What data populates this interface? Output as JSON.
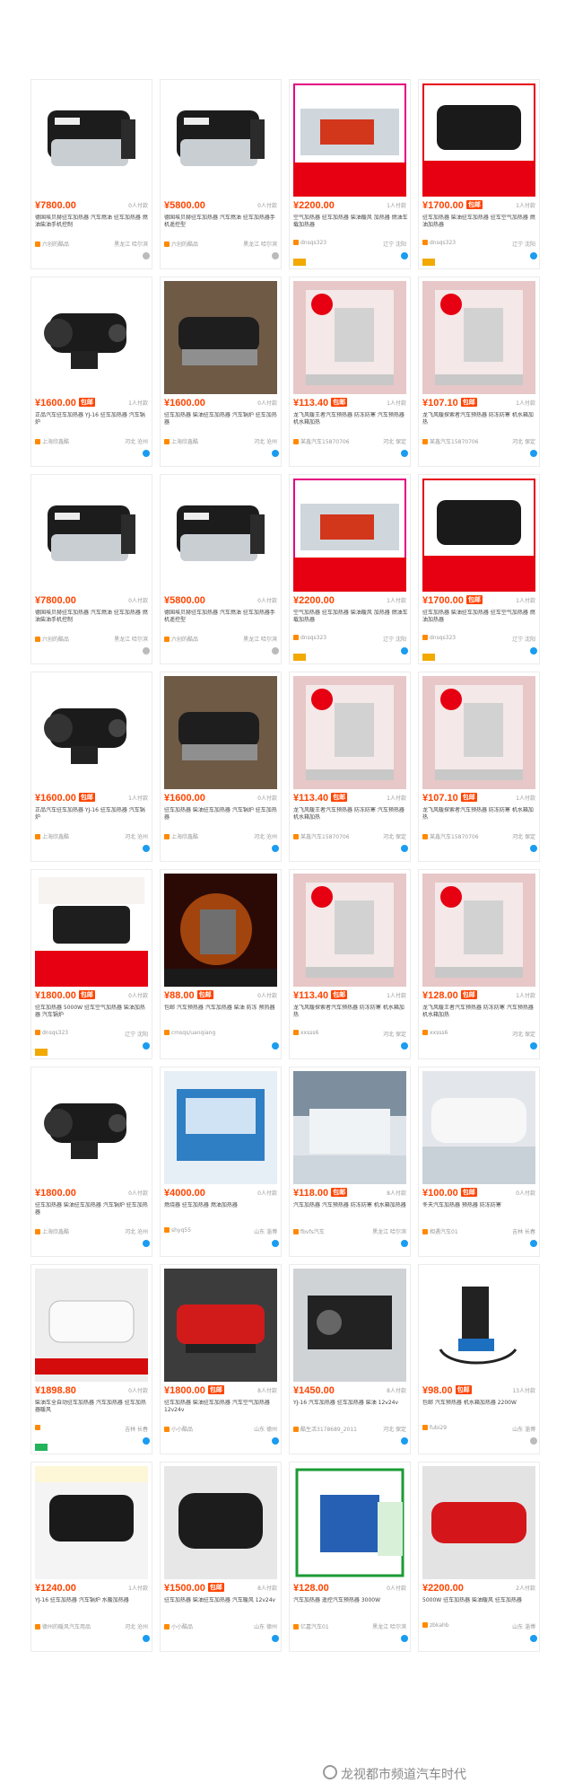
{
  "watermark": "龙视都市频道汽车时代",
  "rows": [
    [
      {
        "img": "heater-silver",
        "price": "¥7800.00",
        "badge": "",
        "sales": "0人付款",
        "t1": "德国埃贝赫驻车加热器 汽车燃油 驻车加热器 燃油柴油手机控制",
        "shop": "六创的酷品",
        "loc": "黑龙江 哈尔滨",
        "tags": [],
        "wang": "grey"
      },
      {
        "img": "heater-silver",
        "price": "¥5800.00",
        "badge": "",
        "sales": "0人付款",
        "t1": "德国埃贝赫驻车加热器 汽车燃油 驻车加热器手机遥控型",
        "shop": "六创的酷品",
        "loc": "黑龙江 哈尔滨",
        "tags": [],
        "wang": "grey"
      },
      {
        "img": "poster-red",
        "price": "¥2200.00",
        "badge": "",
        "sales": "1人付款",
        "t1": "空气加热器 驻车加热器 柴油暖风 加热器 燃油车载加热器",
        "shop": "dnsqs323",
        "loc": "辽宁 沈阳",
        "tags": [
          "gold"
        ],
        "wang": "blue"
      },
      {
        "img": "poster-black",
        "price": "¥1700.00",
        "badge": "包邮",
        "sales": "1人付款",
        "t1": "驻车加热器 柴油驻车加热器 驻车空气加热器 燃油加热器",
        "shop": "dnsqs323",
        "loc": "辽宁 沈阳",
        "tags": [
          "gold"
        ],
        "wang": "blue"
      }
    ],
    [
      {
        "img": "heater-black",
        "price": "¥1600.00",
        "badge": "包邮",
        "sales": "1人付款",
        "t1": "正品汽车驻车加热器 YJ-16 驻车加热器 汽车锅炉",
        "shop": "上海欣鑫酷",
        "loc": "河北 沧州",
        "tags": [],
        "wang": "blue"
      },
      {
        "img": "heater-car",
        "price": "¥1600.00",
        "badge": "",
        "sales": "0人付款",
        "t1": "驻车加热器 柴油驻车加热器 汽车锅炉 驻车加热器",
        "shop": "上海欣鑫酷",
        "loc": "河北 沧州",
        "tags": [],
        "wang": "blue"
      },
      {
        "img": "box-pink",
        "price": "¥113.40",
        "badge": "包邮",
        "sales": "1人付款",
        "t1": "龙飞风暖王者汽车预热器 防冻防寒 汽车预热器 机水箱加热",
        "shop": "某鑫汽车15870706",
        "loc": "河北 保定",
        "tags": [],
        "wang": "blue"
      },
      {
        "img": "box-pink",
        "price": "¥107.10",
        "badge": "包邮",
        "sales": "1人付款",
        "t1": "龙飞风暖探索者汽车预热器 防冻防寒 机水箱加热",
        "shop": "某鑫汽车15870706",
        "loc": "河北 保定",
        "tags": [],
        "wang": "blue"
      }
    ],
    [
      {
        "img": "heater-silver",
        "price": "¥7800.00",
        "badge": "",
        "sales": "0人付款",
        "t1": "德国埃贝赫驻车加热器 汽车燃油 驻车加热器 燃油柴油手机控制",
        "shop": "六创的酷品",
        "loc": "黑龙江 哈尔滨",
        "tags": [],
        "wang": "grey"
      },
      {
        "img": "heater-silver",
        "price": "¥5800.00",
        "badge": "",
        "sales": "0人付款",
        "t1": "德国埃贝赫驻车加热器 汽车燃油 驻车加热器手机遥控型",
        "shop": "六创的酷品",
        "loc": "黑龙江 哈尔滨",
        "tags": [],
        "wang": "grey"
      },
      {
        "img": "poster-red",
        "price": "¥2200.00",
        "badge": "",
        "sales": "1人付款",
        "t1": "空气加热器 驻车加热器 柴油暖风 加热器 燃油车载加热器",
        "shop": "dnsqs323",
        "loc": "辽宁 沈阳",
        "tags": [
          "gold"
        ],
        "wang": "blue"
      },
      {
        "img": "poster-black",
        "price": "¥1700.00",
        "badge": "包邮",
        "sales": "1人付款",
        "t1": "驻车加热器 柴油驻车加热器 驻车空气加热器 燃油加热器",
        "shop": "dnsqs323",
        "loc": "辽宁 沈阳",
        "tags": [
          "gold"
        ],
        "wang": "blue"
      }
    ],
    [
      {
        "img": "heater-black",
        "price": "¥1600.00",
        "badge": "包邮",
        "sales": "1人付款",
        "t1": "正品汽车驻车加热器 YJ-16 驻车加热器 汽车锅炉",
        "shop": "上海欣鑫酷",
        "loc": "河北 沧州",
        "tags": [],
        "wang": "blue"
      },
      {
        "img": "heater-car",
        "price": "¥1600.00",
        "badge": "",
        "sales": "0人付款",
        "t1": "驻车加热器 柴油驻车加热器 汽车锅炉 驻车加热器",
        "shop": "上海欣鑫酷",
        "loc": "河北 沧州",
        "tags": [],
        "wang": "blue"
      },
      {
        "img": "box-pink",
        "price": "¥113.40",
        "badge": "包邮",
        "sales": "1人付款",
        "t1": "龙飞风暖王者汽车预热器 防冻防寒 汽车预热器 机水箱加热",
        "shop": "某鑫汽车15870706",
        "loc": "河北 保定",
        "tags": [],
        "wang": "blue"
      },
      {
        "img": "box-pink",
        "price": "¥107.10",
        "badge": "包邮",
        "sales": "1人付款",
        "t1": "龙飞风暖探索者汽车预热器 防冻防寒 机水箱加热",
        "shop": "某鑫汽车15870706",
        "loc": "河北 保定",
        "tags": [],
        "wang": "blue"
      }
    ],
    [
      {
        "img": "poster-xl",
        "price": "¥1800.00",
        "badge": "包邮",
        "sales": "0人付款",
        "t1": "驻车加热器 5000W 驻车空气加热器 柴油加热器 汽车锅炉",
        "shop": "dnsqs323",
        "loc": "辽宁 沈阳",
        "tags": [
          "gold"
        ],
        "wang": "blue"
      },
      {
        "img": "fire",
        "price": "¥88.00",
        "badge": "包邮",
        "sales": "0人付款",
        "t1": "包邮 汽车预热器 汽车加热器 柴油 防冻 预热器",
        "shop": "cmsqs/uanqiang",
        "loc": "",
        "tags": [],
        "wang": "blue"
      },
      {
        "img": "box-pink",
        "price": "¥113.40",
        "badge": "包邮",
        "sales": "1人付款",
        "t1": "龙飞风暖探索者汽车预热器 防冻防寒 机水箱加热",
        "shop": "xxsss6",
        "loc": "河北 保定",
        "tags": [],
        "wang": "blue"
      },
      {
        "img": "box-pink",
        "price": "¥128.00",
        "badge": "包邮",
        "sales": "1人付款",
        "t1": "龙飞风暖王者汽车预热器 防冻防寒 汽车预热器 机水箱加热",
        "shop": "xxsss6",
        "loc": "河北 保定",
        "tags": [],
        "wang": "blue"
      }
    ],
    [
      {
        "img": "heater-black",
        "price": "¥1800.00",
        "badge": "",
        "sales": "0人付款",
        "t1": "驻车加热器 柴油驻车加热器 汽车锅炉 驻车加热器",
        "shop": "上海欣鑫酷",
        "loc": "河北 沧州",
        "tags": [],
        "wang": "blue"
      },
      {
        "img": "blue-box",
        "price": "¥4000.00",
        "badge": "",
        "sales": "0人付款",
        "t1": "燃烧器 驻车加热器 燃油加热器",
        "shop": "shyq55",
        "loc": "山东 淄博",
        "tags": [],
        "wang": "blue"
      },
      {
        "img": "snow",
        "price": "¥118.00",
        "badge": "包邮",
        "sales": "8人付款",
        "t1": "汽车加热器 汽车预热器 防冻防寒 机水箱加热器",
        "shop": "fbvfs汽车",
        "loc": "黑龙江 哈尔滨",
        "tags": [],
        "wang": "blue"
      },
      {
        "img": "snow-car",
        "price": "¥100.00",
        "badge": "包邮",
        "sales": "0人付款",
        "t1": "冬天汽车加热器 预热器 防冻防寒",
        "shop": "相遇汽车01",
        "loc": "吉林 长春",
        "tags": [],
        "wang": "blue"
      }
    ],
    [
      {
        "img": "white-heater",
        "price": "¥1898.80",
        "badge": "",
        "sales": "0人付款",
        "t1": "柴油车全自动驻车加热器 汽车加热器 驻车加热器暖风",
        "shop": "",
        "loc": "吉林 长春",
        "tags": [
          "green"
        ],
        "wang": "blue"
      },
      {
        "img": "red-heater",
        "price": "¥1800.00",
        "badge": "包邮",
        "sales": "8人付款",
        "t1": "驻车加热器 柴油驻车加热器 汽车空气加热器 12v24v",
        "shop": "小小酷品",
        "loc": "山东 德州",
        "tags": [],
        "wang": "blue"
      },
      {
        "img": "engine",
        "price": "¥1450.00",
        "badge": "",
        "sales": "8人付款",
        "t1": "YJ-16 汽车加热器 驻车加热器 柴油 12v24v",
        "shop": "酷生活3178689_2011",
        "loc": "河北 保定",
        "tags": [],
        "wang": "blue"
      },
      {
        "img": "pump",
        "price": "¥98.00",
        "badge": "包邮",
        "sales": "13人付款",
        "t1": "包邮 汽车预热器 机水箱加热器 2200W",
        "shop": "fubi29",
        "loc": "山东 淄博",
        "tags": [],
        "wang": "grey"
      }
    ],
    [
      {
        "img": "service",
        "price": "¥1240.00",
        "badge": "",
        "sales": "1人付款",
        "t1": "YJ-16 驻车加热器 汽车锅炉 水暖加热器",
        "shop": "德州的暖风汽车用品",
        "loc": "河北 沧州",
        "tags": [],
        "wang": "blue"
      },
      {
        "img": "black-heater",
        "price": "¥1500.00",
        "badge": "包邮",
        "sales": "8人付款",
        "t1": "驻车加热器 柴油驻车加热器 汽车暖风 12v24v",
        "shop": "小小酷品",
        "loc": "山东 德州",
        "tags": [],
        "wang": "blue"
      },
      {
        "img": "remote",
        "price": "¥128.00",
        "badge": "",
        "sales": "0人付款",
        "t1": "汽车加热器 遥控汽车预热器 3000W",
        "shop": "亿嘉汽车01",
        "loc": "黑龙江 哈尔滨",
        "tags": [],
        "wang": "blue"
      },
      {
        "img": "red-heater2",
        "price": "¥2200.00",
        "badge": "",
        "sales": "2人付款",
        "t1": "5000W 驻车加热器 柴油暖风 驻车加热器",
        "shop": "zbkahb",
        "loc": "山东 淄博",
        "tags": [],
        "wang": "blue"
      }
    ]
  ]
}
